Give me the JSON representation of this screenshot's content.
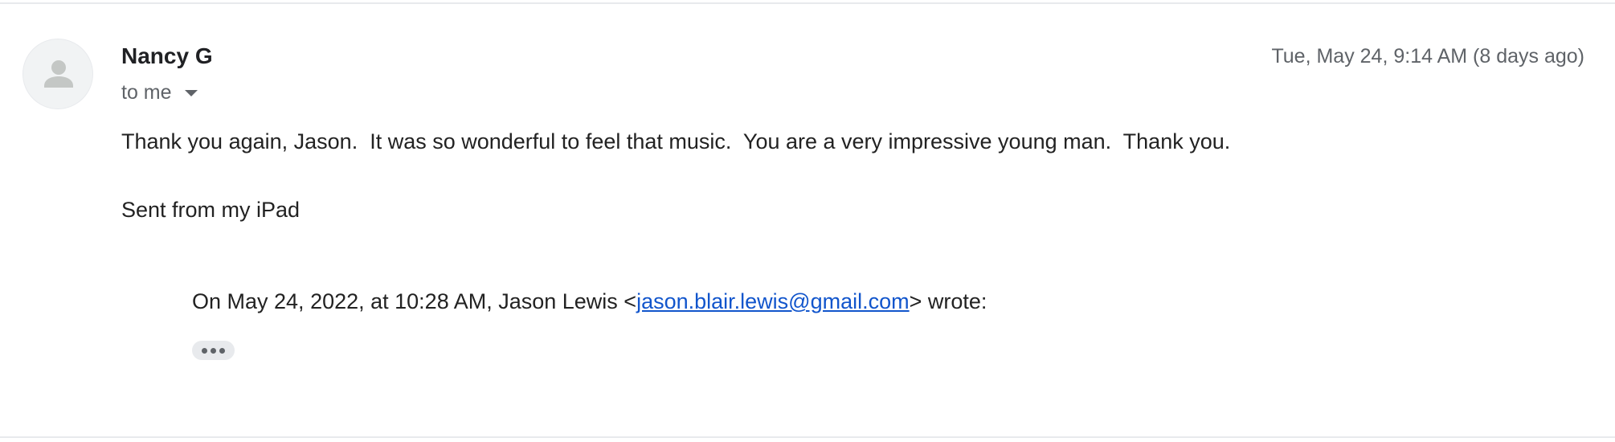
{
  "message": {
    "sender_name": "Nancy G",
    "timestamp": "Tue, May 24, 9:14 AM (8 days ago)",
    "recipient_label": "to me",
    "body_line_1": "Thank you again, Jason.  It was so wonderful to feel that music.  You are a very impressive young man.  Thank you.",
    "body_line_2": "Sent from my iPad",
    "quote": {
      "prefix": "On May 24, 2022, at 10:28 AM, Jason Lewis <",
      "email": "jason.blair.lewis@gmail.com",
      "suffix": "> wrote:"
    }
  },
  "icons": {
    "avatar": "person-icon",
    "recipient_toggle": "caret-down-icon",
    "expand_quote": "more-horiz-icon"
  },
  "colors": {
    "link": "#1155cc",
    "secondary_text": "#5f6368",
    "avatar_bg": "#f1f3f4",
    "avatar_glyph": "#c4c7c5"
  }
}
